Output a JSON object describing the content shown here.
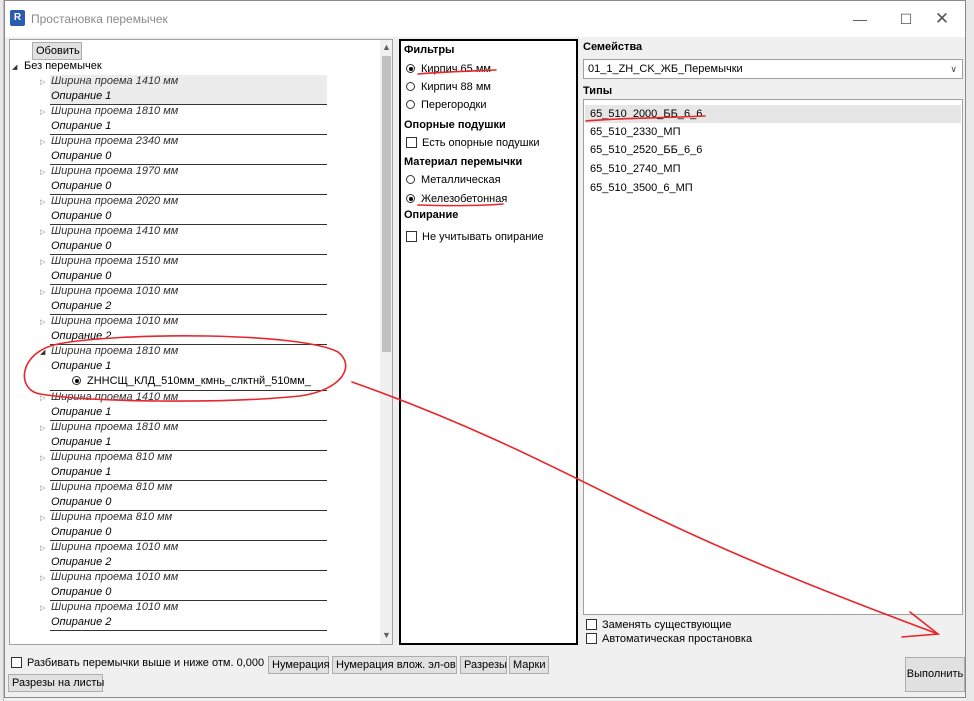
{
  "window": {
    "title": "Простановка перемычек",
    "app_icon": "R"
  },
  "tree": {
    "refresh_label": "Обовить",
    "root_label": "Без перемычек",
    "items": [
      {
        "width": "Ширина проема 1410 мм",
        "support": "Опирание 1"
      },
      {
        "width": "Ширина проема 1810 мм",
        "support": "Опирание 1"
      },
      {
        "width": "Ширина проема 2340 мм",
        "support": "Опирание 0"
      },
      {
        "width": "Ширина проема 1970 мм",
        "support": "Опирание 0"
      },
      {
        "width": "Ширина проема 2020 мм",
        "support": "Опирание 0"
      },
      {
        "width": "Ширина проема 1410 мм",
        "support": "Опирание 0"
      },
      {
        "width": "Ширина проема 1510 мм",
        "support": "Опирание 0"
      },
      {
        "width": "Ширина проема 1010 мм",
        "support": "Опирание 2"
      },
      {
        "width": "Ширина проема 1010 мм",
        "support": "Опирание 2"
      },
      {
        "width": "Ширина проема 1810 мм",
        "support": "Опирание 1",
        "child": "ZННСЩ_КЛД_510мм_кмнь_слктнй_510мм_"
      },
      {
        "width": "Ширина проема 1410 мм",
        "support": "Опирание 1"
      },
      {
        "width": "Ширина проема 1810 мм",
        "support": "Опирание 1"
      },
      {
        "width": "Ширина проема 810 мм",
        "support": "Опирание 1"
      },
      {
        "width": "Ширина проема 810 мм",
        "support": "Опирание 0"
      },
      {
        "width": "Ширина проема 810 мм",
        "support": "Опирание 0"
      },
      {
        "width": "Ширина проема 1010 мм",
        "support": "Опирание 2"
      },
      {
        "width": "Ширина проема 1010 мм",
        "support": "Опирание 0"
      },
      {
        "width": "Ширина проема 1010 мм",
        "support": "Опирание 2"
      }
    ]
  },
  "filters": {
    "header": "Фильтры",
    "options": [
      {
        "label": "Кирпич 65 мм",
        "checked": true
      },
      {
        "label": "Кирпич 88 мм",
        "checked": false
      },
      {
        "label": "Перегородки",
        "checked": false
      }
    ],
    "pads_header": "Опорные подушки",
    "pads_option": "Есть опорные подушки",
    "material_header": "Материал перемычки",
    "materials": [
      {
        "label": "Металлическая",
        "checked": false
      },
      {
        "label": "Железобетонная",
        "checked": true
      }
    ],
    "support_header": "Опирание",
    "support_option": "Не учитывать опирание"
  },
  "families": {
    "label": "Семейства",
    "selected": "01_1_ZH_CK_ЖБ_Перемычки"
  },
  "types": {
    "label": "Типы",
    "items": [
      "65_510_2000_ББ_6_6",
      "65_510_2330_МП",
      "65_510_2520_ББ_6_6",
      "65_510_2740_МП",
      "65_510_3500_6_МП"
    ]
  },
  "options": {
    "replace_existing": "Заменять существующие",
    "auto_place": "Автоматическая простановка",
    "split_label": "Разбивать перемычки выше и ниже отм. 0,000"
  },
  "buttons": {
    "numbering": "Нумерация",
    "numbering_nested": "Нумерация влож. эл-ов",
    "sections": "Разрезы",
    "marks": "Марки",
    "sections_to_sheets": "Разрезы на листы",
    "run": "Выполнить"
  },
  "colors": {
    "annotation": "#e8262b",
    "selection": "#e6e6e6"
  }
}
